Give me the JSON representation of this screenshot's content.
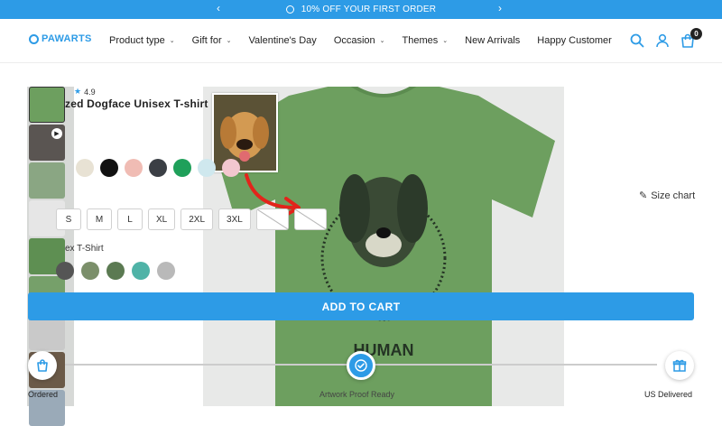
{
  "announcement": {
    "text": "10% OFF YOUR FIRST ORDER",
    "prev": "‹",
    "next": "›"
  },
  "header": {
    "logo": "PAWARTS",
    "nav": [
      {
        "label": "Product type",
        "dropdown": true
      },
      {
        "label": "Gift for",
        "dropdown": true
      },
      {
        "label": "Valentine's Day",
        "dropdown": false
      },
      {
        "label": "Occasion",
        "dropdown": true
      },
      {
        "label": "Themes",
        "dropdown": true
      },
      {
        "label": "New Arrivals",
        "dropdown": false
      },
      {
        "label": "Happy Customer",
        "dropdown": false
      }
    ],
    "cart_count": "0"
  },
  "product": {
    "rating": "4.9",
    "title": "zed Dogface Unisex T-shirt",
    "size_chart": "Size chart",
    "sizes": [
      "S",
      "M",
      "L",
      "XL",
      "2XL",
      "3XL",
      "",
      ""
    ],
    "style_label": "ex T-Shirt",
    "add_to_cart": "ADD TO CART",
    "shirt_text": "HUMAN"
  },
  "steps": {
    "ordered": "Ordered",
    "proof": "Artwork Proof Ready",
    "delivered": "US Delivered"
  },
  "colors": {
    "brand": "#2d9be6",
    "shirt_green": "#6d9f5f"
  }
}
